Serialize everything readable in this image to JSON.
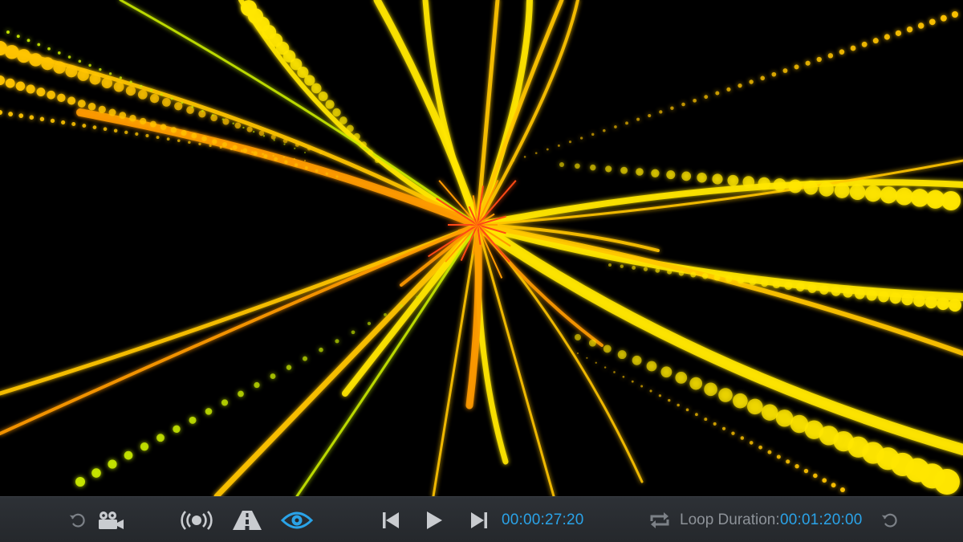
{
  "viewport": {
    "content": "particle-burst-animation",
    "colors": {
      "background": "#000000",
      "yellow": "#ffe600",
      "gold": "#ffc400",
      "orange": "#ff9a00",
      "red_orange": "#ff4a12",
      "lime": "#c8e800"
    }
  },
  "toolbar": {
    "icons": {
      "reset_camera": "rotate-ccw-icon",
      "camera": "movie-camera-icon",
      "broadcast": "broadcast-icon",
      "perspective": "road-icon",
      "view": "eye-icon",
      "skip_back": "skip-back-icon",
      "play": "play-icon",
      "skip_forward": "skip-forward-icon",
      "loop": "loop-icon",
      "reset_loop": "rotate-ccw-icon"
    },
    "current_time": "00:00:27:20",
    "loop_label": "Loop Duration:",
    "loop_duration": "00:01:20:00",
    "colors": {
      "background": "#2a2e33",
      "icon": "#7c8187",
      "icon_light": "#c9ccd0",
      "active": "#2aa3e8",
      "label": "#8d9298"
    }
  }
}
